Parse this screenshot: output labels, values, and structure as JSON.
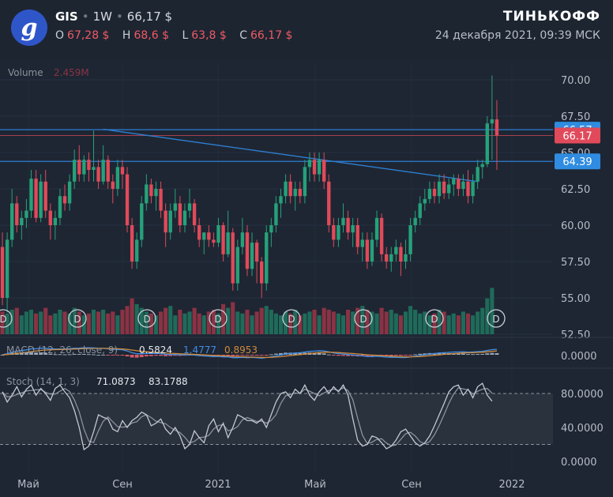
{
  "header": {
    "ticker": "GIS",
    "interval": "1W",
    "last_price": "66,17 $",
    "ohlc": [
      {
        "key": "O",
        "value": "67,28 $"
      },
      {
        "key": "H",
        "value": "68,6 $"
      },
      {
        "key": "L",
        "value": "63,8 $"
      },
      {
        "key": "C",
        "value": "66,17 $"
      }
    ],
    "brand": "ТИНЬКОФФ",
    "timestamp": "24 декабря 2021, 09:39 МСК",
    "logo_glyph": "g"
  },
  "colors": {
    "background": "#1e2633",
    "up": "#26a17a",
    "down": "#e04a5a",
    "volume_up": "#1f6b5a",
    "volume_down": "#8a3344",
    "line_blue": "#2d7fd4",
    "price_badge_blue": "#2f8ce0",
    "price_badge_red": "#e04a5a",
    "macd_line": "#3f8ee8",
    "signal_line": "#d08a3a",
    "stoch_k": "#c4c8ce",
    "stoch_d": "#8a93a0"
  },
  "chart_data": [
    {
      "type": "candlestick",
      "symbol": "GIS",
      "interval": "1W",
      "y_ticks": [
        "70.00",
        "67.50",
        "65.00",
        "62.50",
        "60.00",
        "57.50",
        "55.00",
        "52.50"
      ],
      "ylim": [
        52.5,
        71.2
      ],
      "x_ticks": [
        "Май",
        "Сен",
        "2021",
        "Май",
        "Сен",
        "2022"
      ],
      "price_badges": [
        "66.57",
        "66.17",
        "64.39"
      ],
      "horizontal_levels": [
        66.57,
        64.39
      ],
      "trendline": {
        "from": [
          2020.79,
          66.6
        ],
        "to": [
          2021.95,
          63.0
        ]
      },
      "volume_label": "Volume",
      "volume_value": "2.459M",
      "dividend_marker": "D",
      "candles": [
        {
          "o": 58.5,
          "h": 59.5,
          "l": 54.5,
          "c": 55.0
        },
        {
          "o": 55.0,
          "h": 59.5,
          "l": 54.0,
          "c": 59.0
        },
        {
          "o": 59.0,
          "h": 62.5,
          "l": 58.5,
          "c": 61.5
        },
        {
          "o": 61.5,
          "h": 62.0,
          "l": 59.5,
          "c": 60.0
        },
        {
          "o": 60.0,
          "h": 61.0,
          "l": 59.0,
          "c": 60.5
        },
        {
          "o": 60.5,
          "h": 61.8,
          "l": 59.8,
          "c": 61.0
        },
        {
          "o": 61.0,
          "h": 63.8,
          "l": 60.5,
          "c": 63.2
        },
        {
          "o": 63.2,
          "h": 63.8,
          "l": 60.2,
          "c": 60.5
        },
        {
          "o": 60.5,
          "h": 63.5,
          "l": 60.2,
          "c": 63.0
        },
        {
          "o": 63.0,
          "h": 63.8,
          "l": 60.5,
          "c": 61.0
        },
        {
          "o": 61.0,
          "h": 61.5,
          "l": 59.0,
          "c": 60.0
        },
        {
          "o": 60.0,
          "h": 61.0,
          "l": 59.0,
          "c": 60.5
        },
        {
          "o": 60.5,
          "h": 62.5,
          "l": 60.0,
          "c": 62.0
        },
        {
          "o": 62.0,
          "h": 62.8,
          "l": 61.0,
          "c": 61.5
        },
        {
          "o": 61.5,
          "h": 63.5,
          "l": 61.0,
          "c": 63.0
        },
        {
          "o": 63.0,
          "h": 65.2,
          "l": 62.5,
          "c": 64.5
        },
        {
          "o": 64.5,
          "h": 65.5,
          "l": 63.0,
          "c": 63.5
        },
        {
          "o": 63.5,
          "h": 64.8,
          "l": 63.0,
          "c": 64.5
        },
        {
          "o": 64.5,
          "h": 65.0,
          "l": 63.0,
          "c": 63.8
        },
        {
          "o": 63.8,
          "h": 66.5,
          "l": 63.0,
          "c": 64.0
        },
        {
          "o": 64.0,
          "h": 64.5,
          "l": 62.5,
          "c": 63.0
        },
        {
          "o": 63.0,
          "h": 65.5,
          "l": 62.8,
          "c": 64.5
        },
        {
          "o": 64.5,
          "h": 64.8,
          "l": 62.5,
          "c": 63.0
        },
        {
          "o": 63.0,
          "h": 63.5,
          "l": 61.5,
          "c": 62.5
        },
        {
          "o": 62.5,
          "h": 64.5,
          "l": 62.0,
          "c": 64.0
        },
        {
          "o": 64.0,
          "h": 64.5,
          "l": 62.5,
          "c": 63.5
        },
        {
          "o": 63.5,
          "h": 64.0,
          "l": 59.5,
          "c": 60.0
        },
        {
          "o": 60.0,
          "h": 60.5,
          "l": 57.0,
          "c": 57.5
        },
        {
          "o": 57.5,
          "h": 59.5,
          "l": 57.0,
          "c": 59.0
        },
        {
          "o": 59.0,
          "h": 62.0,
          "l": 58.5,
          "c": 61.5
        },
        {
          "o": 61.5,
          "h": 63.5,
          "l": 61.0,
          "c": 62.8
        },
        {
          "o": 62.8,
          "h": 63.2,
          "l": 61.5,
          "c": 62.0
        },
        {
          "o": 62.0,
          "h": 63.0,
          "l": 61.0,
          "c": 62.5
        },
        {
          "o": 62.5,
          "h": 63.0,
          "l": 60.5,
          "c": 61.0
        },
        {
          "o": 61.0,
          "h": 61.5,
          "l": 58.5,
          "c": 59.5
        },
        {
          "o": 59.5,
          "h": 61.5,
          "l": 59.0,
          "c": 61.0
        },
        {
          "o": 61.0,
          "h": 62.5,
          "l": 60.5,
          "c": 61.5
        },
        {
          "o": 61.5,
          "h": 62.0,
          "l": 59.5,
          "c": 60.0
        },
        {
          "o": 60.0,
          "h": 61.5,
          "l": 59.5,
          "c": 61.0
        },
        {
          "o": 61.0,
          "h": 62.5,
          "l": 60.5,
          "c": 61.5
        },
        {
          "o": 61.5,
          "h": 61.8,
          "l": 59.5,
          "c": 60.0
        },
        {
          "o": 60.0,
          "h": 60.5,
          "l": 58.5,
          "c": 59.0
        },
        {
          "o": 59.0,
          "h": 59.5,
          "l": 58.0,
          "c": 59.5
        },
        {
          "o": 59.5,
          "h": 60.0,
          "l": 58.5,
          "c": 59.0
        },
        {
          "o": 59.0,
          "h": 59.5,
          "l": 58.5,
          "c": 58.8
        },
        {
          "o": 58.8,
          "h": 60.5,
          "l": 58.5,
          "c": 60.0
        },
        {
          "o": 60.0,
          "h": 60.2,
          "l": 57.5,
          "c": 58.0
        },
        {
          "o": 58.0,
          "h": 61.0,
          "l": 57.8,
          "c": 59.5
        },
        {
          "o": 59.5,
          "h": 59.8,
          "l": 55.5,
          "c": 56.0
        },
        {
          "o": 56.0,
          "h": 59.0,
          "l": 55.5,
          "c": 58.5
        },
        {
          "o": 58.5,
          "h": 60.5,
          "l": 58.0,
          "c": 59.5
        },
        {
          "o": 59.5,
          "h": 60.0,
          "l": 56.5,
          "c": 57.0
        },
        {
          "o": 57.0,
          "h": 59.5,
          "l": 56.5,
          "c": 58.8
        },
        {
          "o": 58.8,
          "h": 59.0,
          "l": 56.0,
          "c": 57.5
        },
        {
          "o": 57.5,
          "h": 57.8,
          "l": 55.0,
          "c": 56.0
        },
        {
          "o": 56.0,
          "h": 60.0,
          "l": 55.5,
          "c": 59.5
        },
        {
          "o": 59.5,
          "h": 60.5,
          "l": 58.5,
          "c": 60.0
        },
        {
          "o": 60.0,
          "h": 62.0,
          "l": 59.5,
          "c": 61.5
        },
        {
          "o": 61.5,
          "h": 62.5,
          "l": 60.5,
          "c": 62.0
        },
        {
          "o": 62.0,
          "h": 63.5,
          "l": 61.5,
          "c": 63.0
        },
        {
          "o": 63.0,
          "h": 63.5,
          "l": 61.5,
          "c": 62.0
        },
        {
          "o": 62.0,
          "h": 63.0,
          "l": 61.0,
          "c": 62.5
        },
        {
          "o": 62.5,
          "h": 63.0,
          "l": 61.5,
          "c": 62.0
        },
        {
          "o": 62.0,
          "h": 64.5,
          "l": 61.5,
          "c": 64.0
        },
        {
          "o": 64.0,
          "h": 65.0,
          "l": 63.0,
          "c": 64.5
        },
        {
          "o": 64.5,
          "h": 65.0,
          "l": 63.0,
          "c": 63.5
        },
        {
          "o": 63.5,
          "h": 65.0,
          "l": 63.0,
          "c": 64.5
        },
        {
          "o": 64.5,
          "h": 65.0,
          "l": 62.5,
          "c": 63.0
        },
        {
          "o": 63.0,
          "h": 63.5,
          "l": 59.5,
          "c": 60.0
        },
        {
          "o": 60.0,
          "h": 60.5,
          "l": 58.5,
          "c": 59.0
        },
        {
          "o": 59.0,
          "h": 60.5,
          "l": 58.5,
          "c": 60.0
        },
        {
          "o": 60.0,
          "h": 61.5,
          "l": 59.5,
          "c": 60.5
        },
        {
          "o": 60.5,
          "h": 61.0,
          "l": 59.0,
          "c": 59.5
        },
        {
          "o": 59.5,
          "h": 60.5,
          "l": 58.5,
          "c": 60.0
        },
        {
          "o": 60.0,
          "h": 60.5,
          "l": 58.0,
          "c": 58.5
        },
        {
          "o": 58.5,
          "h": 59.5,
          "l": 57.5,
          "c": 59.0
        },
        {
          "o": 59.0,
          "h": 59.5,
          "l": 57.0,
          "c": 57.5
        },
        {
          "o": 57.5,
          "h": 59.5,
          "l": 57.2,
          "c": 59.0
        },
        {
          "o": 59.0,
          "h": 61.0,
          "l": 58.5,
          "c": 60.5
        },
        {
          "o": 60.5,
          "h": 60.8,
          "l": 57.5,
          "c": 58.0
        },
        {
          "o": 58.0,
          "h": 58.5,
          "l": 57.0,
          "c": 57.5
        },
        {
          "o": 57.5,
          "h": 58.5,
          "l": 56.8,
          "c": 58.0
        },
        {
          "o": 58.0,
          "h": 59.0,
          "l": 57.5,
          "c": 58.5
        },
        {
          "o": 58.5,
          "h": 58.8,
          "l": 56.5,
          "c": 57.5
        },
        {
          "o": 57.5,
          "h": 59.0,
          "l": 57.0,
          "c": 58.0
        },
        {
          "o": 58.0,
          "h": 60.5,
          "l": 57.5,
          "c": 60.0
        },
        {
          "o": 60.0,
          "h": 61.0,
          "l": 59.5,
          "c": 60.5
        },
        {
          "o": 60.5,
          "h": 62.0,
          "l": 60.0,
          "c": 61.5
        },
        {
          "o": 61.5,
          "h": 62.5,
          "l": 61.0,
          "c": 61.8
        },
        {
          "o": 61.8,
          "h": 63.0,
          "l": 61.5,
          "c": 62.5
        },
        {
          "o": 62.5,
          "h": 63.0,
          "l": 61.5,
          "c": 62.0
        },
        {
          "o": 62.0,
          "h": 63.5,
          "l": 61.5,
          "c": 63.0
        },
        {
          "o": 63.0,
          "h": 63.5,
          "l": 61.8,
          "c": 62.2
        },
        {
          "o": 62.2,
          "h": 63.2,
          "l": 61.8,
          "c": 62.8
        },
        {
          "o": 62.8,
          "h": 63.5,
          "l": 62.0,
          "c": 63.2
        },
        {
          "o": 63.2,
          "h": 63.5,
          "l": 62.0,
          "c": 62.5
        },
        {
          "o": 62.5,
          "h": 63.5,
          "l": 62.0,
          "c": 63.0
        },
        {
          "o": 63.0,
          "h": 63.8,
          "l": 61.5,
          "c": 62.0
        },
        {
          "o": 62.0,
          "h": 63.5,
          "l": 61.5,
          "c": 63.0
        },
        {
          "o": 63.0,
          "h": 64.5,
          "l": 62.5,
          "c": 64.0
        },
        {
          "o": 64.0,
          "h": 64.5,
          "l": 63.2,
          "c": 64.2
        },
        {
          "o": 64.2,
          "h": 67.5,
          "l": 64.0,
          "c": 67.0
        },
        {
          "o": 67.0,
          "h": 70.3,
          "l": 64.5,
          "c": 67.28
        },
        {
          "o": 67.28,
          "h": 68.6,
          "l": 63.8,
          "c": 66.17
        }
      ],
      "volumes": [
        1.2,
        1.1,
        1.3,
        1.4,
        1.0,
        1.2,
        1.3,
        1.1,
        1.2,
        1.4,
        1.0,
        1.1,
        1.3,
        1.2,
        1.1,
        1.4,
        1.2,
        1.0,
        1.1,
        1.3,
        1.2,
        1.3,
        1.1,
        1.2,
        1.0,
        1.3,
        1.5,
        1.9,
        1.6,
        1.4,
        1.2,
        1.1,
        1.0,
        1.2,
        1.4,
        1.5,
        1.0,
        1.3,
        1.1,
        1.2,
        1.4,
        1.1,
        1.0,
        1.2,
        1.3,
        1.1,
        1.6,
        1.4,
        1.7,
        1.2,
        1.1,
        1.3,
        1.0,
        1.2,
        1.4,
        1.5,
        1.3,
        1.1,
        1.0,
        1.2,
        1.1,
        1.3,
        1.0,
        1.1,
        1.2,
        1.3,
        1.0,
        1.4,
        1.3,
        1.2,
        1.1,
        1.0,
        1.3,
        1.2,
        1.4,
        1.5,
        1.3,
        1.2,
        1.1,
        1.4,
        1.2,
        1.3,
        1.1,
        1.0,
        1.2,
        1.5,
        1.3,
        1.1,
        1.2,
        1.0,
        1.1,
        1.3,
        1.2,
        1.0,
        1.1,
        1.0,
        1.2,
        1.1,
        1.0,
        1.2,
        1.4,
        1.9,
        2.459
      ]
    },
    {
      "type": "line",
      "name": "MACD",
      "label": "MACD (12, 26, close, 9)",
      "values_shown": [
        "0.5824",
        "1.4777",
        "0.8953"
      ],
      "y_ticks": [
        "0.0000"
      ]
    },
    {
      "type": "line",
      "name": "Stoch",
      "label": "Stoch (14, 1, 3)",
      "values_shown": [
        "71.0873",
        "83.1788"
      ],
      "y_ticks": [
        "80.0000",
        "40.0000",
        "0.0000"
      ],
      "ylim": [
        -8,
        108
      ],
      "band": [
        20,
        80
      ],
      "k": [
        82,
        70,
        78,
        88,
        76,
        85,
        90,
        78,
        86,
        80,
        72,
        86,
        90,
        82,
        75,
        60,
        40,
        14,
        18,
        35,
        55,
        52,
        50,
        38,
        35,
        48,
        40,
        48,
        52,
        58,
        55,
        42,
        45,
        50,
        38,
        32,
        40,
        30,
        15,
        20,
        36,
        28,
        22,
        42,
        50,
        35,
        45,
        28,
        40,
        55,
        52,
        48,
        48,
        45,
        50,
        40,
        55,
        70,
        80,
        82,
        75,
        85,
        80,
        90,
        78,
        72,
        82,
        88,
        80,
        88,
        82,
        90,
        78,
        50,
        25,
        18,
        20,
        30,
        28,
        22,
        15,
        18,
        25,
        35,
        38,
        30,
        22,
        18,
        22,
        30,
        42,
        55,
        68,
        82,
        88,
        90,
        78,
        85,
        75,
        88,
        92,
        78,
        71
      ]
    }
  ]
}
